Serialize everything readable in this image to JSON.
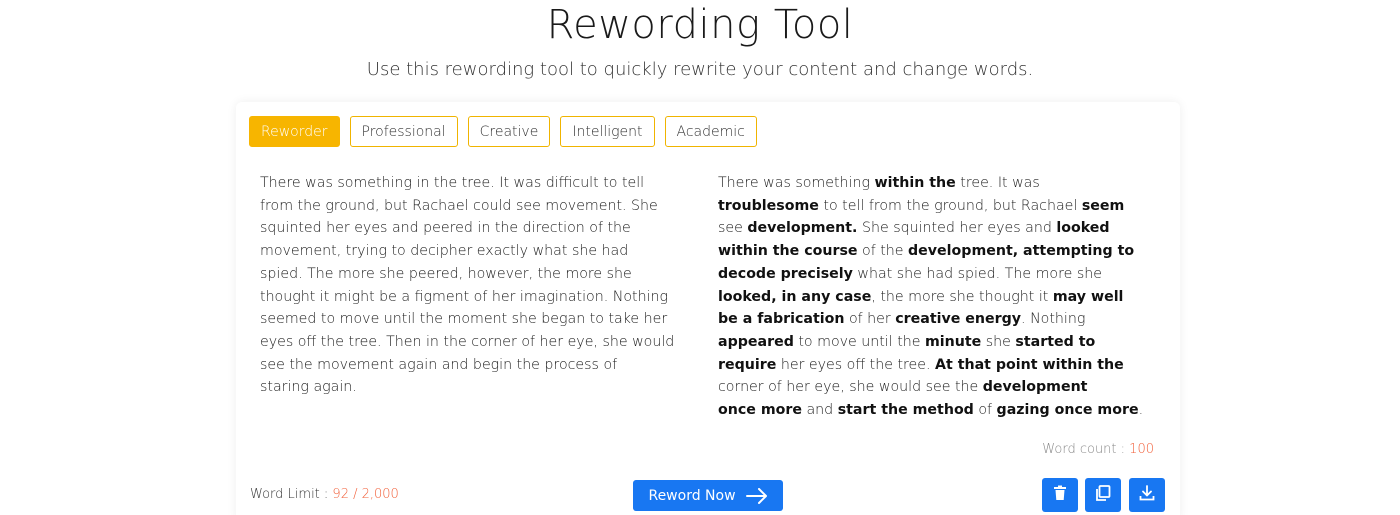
{
  "header": {
    "title": "Rewording Tool",
    "subtitle": "Use this rewording tool to quickly rewrite your content and change words."
  },
  "tabs": [
    {
      "label": "Reworder",
      "active": true
    },
    {
      "label": "Professional",
      "active": false
    },
    {
      "label": "Creative",
      "active": false
    },
    {
      "label": "Intelligent",
      "active": false
    },
    {
      "label": "Academic",
      "active": false
    }
  ],
  "input": {
    "lines": [
      "There was something in the tree. It was difficult to tell",
      "from the ground, but Rachael could see movement. She",
      "squinted her eyes and peered in the direction of the",
      "movement, trying to decipher exactly what she had",
      "spied. The more she peered, however, the more she",
      "thought it might be a figment of her imagination. Nothing",
      "seemed to move until the moment she began to take her",
      "eyes off the tree. Then in the corner of her eye, she would",
      "see the movement again and begin the process of",
      "staring again."
    ]
  },
  "output": {
    "lines": [
      [
        {
          "t": "There was something ",
          "b": false
        },
        {
          "t": "within the",
          "b": true
        },
        {
          "t": " tree. It was",
          "b": false
        }
      ],
      [
        {
          "t": "troublesome",
          "b": true
        },
        {
          "t": " to tell from the ground, but Rachael ",
          "b": false
        },
        {
          "t": "seem",
          "b": true
        }
      ],
      [
        {
          "t": "see ",
          "b": false
        },
        {
          "t": "development.",
          "b": true
        },
        {
          "t": " She squinted her eyes and ",
          "b": false
        },
        {
          "t": "looked",
          "b": true
        }
      ],
      [
        {
          "t": "within the course",
          "b": true
        },
        {
          "t": " of the ",
          "b": false
        },
        {
          "t": "development, attempting to",
          "b": true
        }
      ],
      [
        {
          "t": "decode precisely",
          "b": true
        },
        {
          "t": " what she had spied. The more she",
          "b": false
        }
      ],
      [
        {
          "t": "looked, in any case",
          "b": true
        },
        {
          "t": ", the more she thought it ",
          "b": false
        },
        {
          "t": "may well",
          "b": true
        }
      ],
      [
        {
          "t": "be a fabrication",
          "b": true
        },
        {
          "t": " of her ",
          "b": false
        },
        {
          "t": "creative energy",
          "b": true
        },
        {
          "t": ". Nothing",
          "b": false
        }
      ],
      [
        {
          "t": "appeared",
          "b": true
        },
        {
          "t": " to move until the ",
          "b": false
        },
        {
          "t": "minute",
          "b": true
        },
        {
          "t": " she ",
          "b": false
        },
        {
          "t": "started to",
          "b": true
        }
      ],
      [
        {
          "t": "require",
          "b": true
        },
        {
          "t": " her eyes off the tree. ",
          "b": false
        },
        {
          "t": "At that point within the",
          "b": true
        }
      ],
      [
        {
          "t": "corner of her eye, she would see the ",
          "b": false
        },
        {
          "t": "development",
          "b": true
        }
      ],
      [
        {
          "t": "once more",
          "b": true
        },
        {
          "t": " and ",
          "b": false
        },
        {
          "t": "start the method",
          "b": true
        },
        {
          "t": " of ",
          "b": false
        },
        {
          "t": "gazing once more",
          "b": true
        },
        {
          "t": ".",
          "b": false
        }
      ]
    ]
  },
  "word_count": {
    "label": "Word count : ",
    "value": "100"
  },
  "word_limit": {
    "label": "Word Limit : ",
    "value": "92 / 2,000"
  },
  "actions": {
    "reword_label": "Reword Now",
    "reword_icon": "arrow-right-icon",
    "delete_icon": "trash-icon",
    "copy_icon": "copy-icon",
    "download_icon": "download-icon"
  },
  "colors": {
    "accent": "#f7b500",
    "primary": "#1877f2",
    "highlight": "#f2603a"
  }
}
